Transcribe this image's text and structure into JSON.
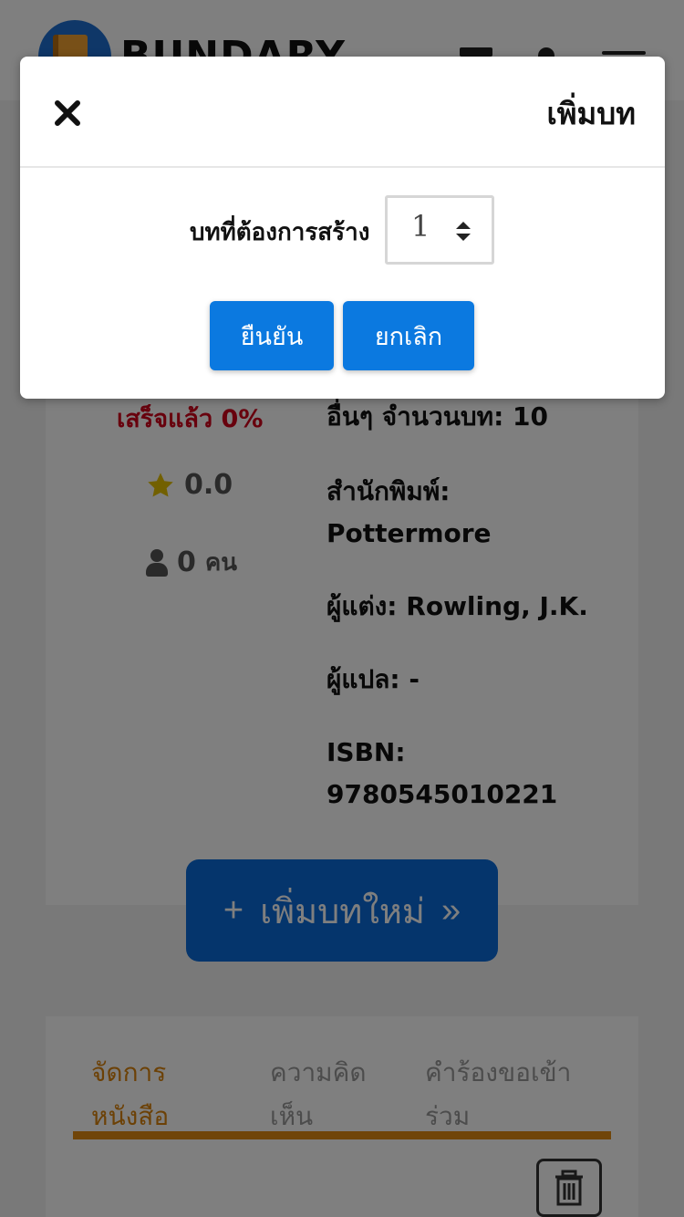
{
  "header": {
    "brand": "BUNDARY",
    "icons": [
      "logo-book-icon",
      "filter-icon",
      "bell-icon",
      "menu-icon"
    ]
  },
  "book": {
    "progress_label": "เสร็จแล้ว 0%",
    "rating": "0.0",
    "voters_count": "0",
    "voters_unit": "คน",
    "genre_label": "อื่นๆ จำนวนบท: 10",
    "publisher_label": "สำนักพิมพ์:",
    "publisher_value": "Pottermore",
    "author_label": "ผู้แต่ง:",
    "author_value": "Rowling, J.K.",
    "translator_label": "ผู้แปล:",
    "translator_value": "-",
    "isbn_label": "ISBN:",
    "isbn_value": "9780545010221",
    "add_chapter_plus": "+",
    "add_chapter_label": "เพิ่มบทใหม่",
    "add_chapter_arrow": "»"
  },
  "tabs": [
    {
      "label_line1": "จัดการ",
      "label_line2": "หนังสือ",
      "active": true
    },
    {
      "label_line1": "ความคิด",
      "label_line2": "เห็น",
      "active": false
    },
    {
      "label_line1": "คำร้องขอเข้า",
      "label_line2": "ร่วม",
      "active": false
    }
  ],
  "modal": {
    "title": "เพิ่มบท",
    "field_label": "บทที่ต้องการสร้าง",
    "stepper_value": "1",
    "confirm_label": "ยืนยัน",
    "cancel_label": "ยกเลิก"
  },
  "colors": {
    "primary": "#0b79e0",
    "progress_red": "#d0021b",
    "tab_active": "#d9820c",
    "star": "#e5c100"
  }
}
